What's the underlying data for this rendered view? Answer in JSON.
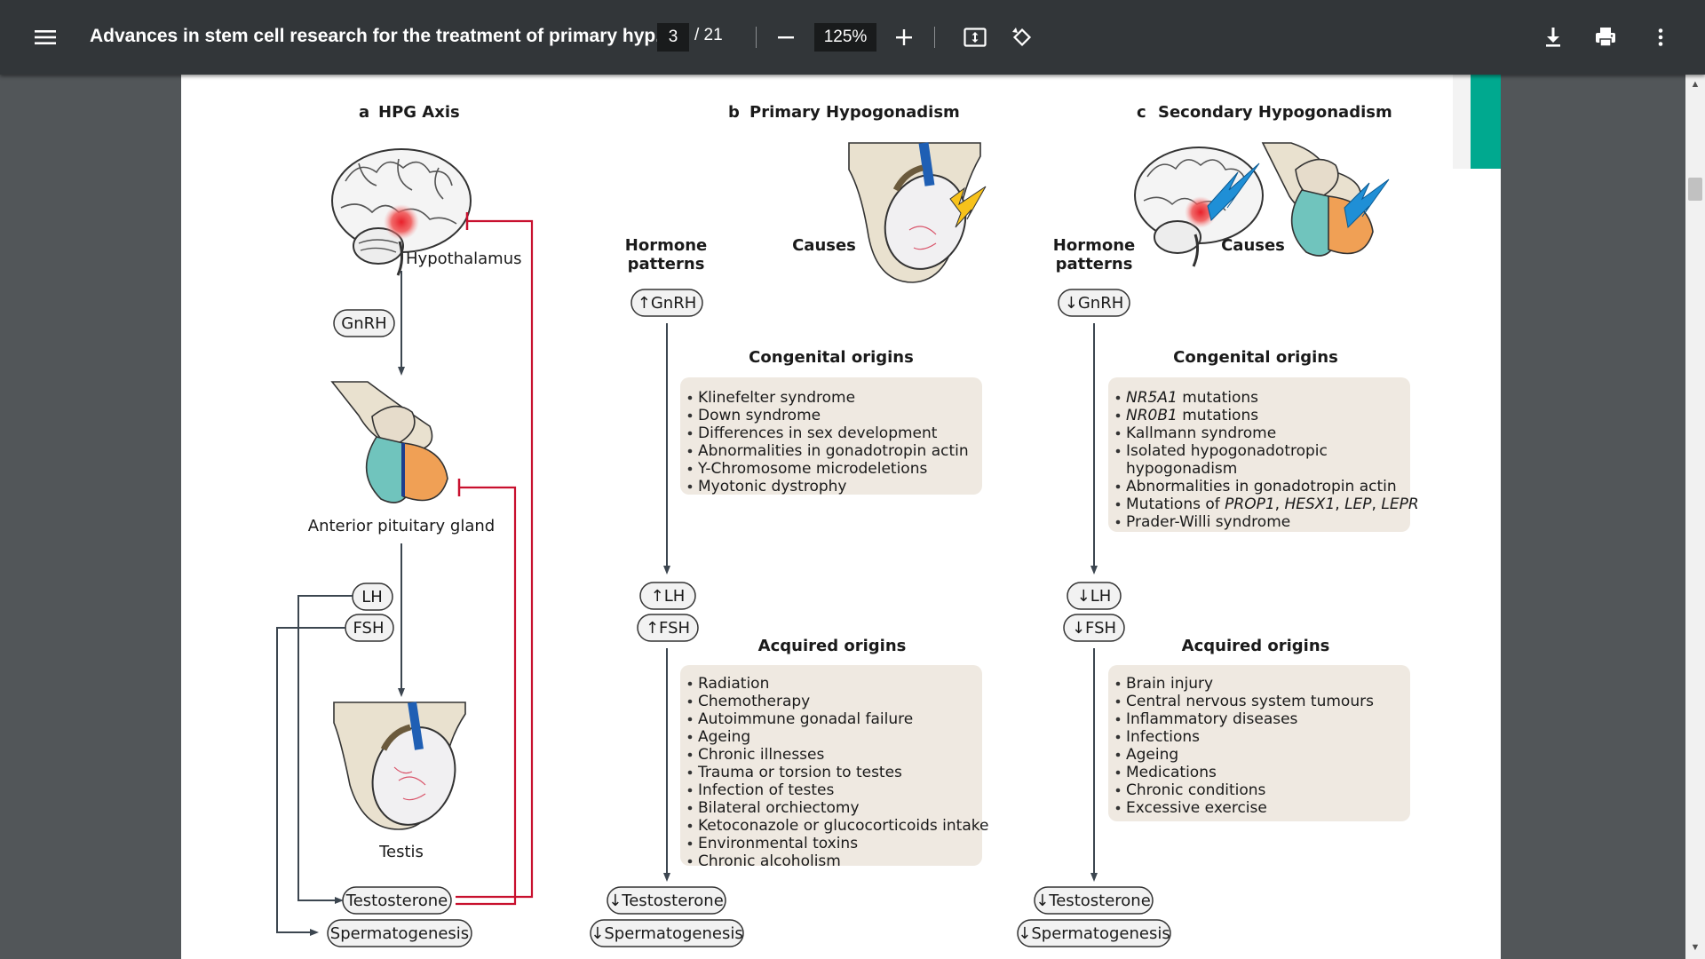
{
  "toolbar": {
    "title": "Advances in stem cell research for the treatment of primary hyp...",
    "page_current": "3",
    "page_total": "/ 21",
    "zoom": "125%"
  },
  "figure": {
    "panel_a": {
      "letter": "a",
      "title": "HPG Axis",
      "hypothalamus": "Hypothalamus",
      "gnrh": "GnRH",
      "pituitary": "Anterior pituitary gland",
      "lh": "LH",
      "fsh": "FSH",
      "testis": "Testis",
      "testosterone": "Testosterone",
      "spermatogenesis": "Spermatogenesis"
    },
    "panel_b": {
      "letter": "b",
      "title": "Primary Hypogonadism",
      "hormone_patterns_1": "Hormone",
      "hormone_patterns_2": "patterns",
      "causes": "Causes",
      "gnrh": "↑GnRH",
      "lh": "↑LH",
      "fsh": "↑FSH",
      "testosterone": "↓Testosterone",
      "spermatogenesis": "↓Spermatogenesis",
      "congenital_title": "Congenital origins",
      "congenital": [
        "Klinefelter syndrome",
        "Down syndrome",
        "Differences in sex development",
        "Abnormalities in gonadotropin actin",
        "Y-Chromosome microdeletions",
        "Myotonic dystrophy"
      ],
      "acquired_title": "Acquired origins",
      "acquired": [
        "Radiation",
        "Chemotherapy",
        "Autoimmune gonadal failure",
        "Ageing",
        "Chronic illnesses",
        "Trauma or torsion to testes",
        "Infection of testes",
        "Bilateral orchiectomy",
        "Ketoconazole or glucocorticoids intake",
        "Environmental toxins",
        "Chronic alcoholism"
      ]
    },
    "panel_c": {
      "letter": "c",
      "title": "Secondary Hypogonadism",
      "hormone_patterns_1": "Hormone",
      "hormone_patterns_2": "patterns",
      "causes": "Causes",
      "gnrh": "↓GnRH",
      "lh": "↓LH",
      "fsh": "↓FSH",
      "testosterone": "↓Testosterone",
      "spermatogenesis": "↓Spermatogenesis",
      "congenital_title": "Congenital origins",
      "congenital": [
        "NR5A1 mutations",
        "NR0B1 mutations",
        "Kallmann syndrome",
        "Isolated hypogonadotropic",
        "hypogonadism",
        "Abnormalities in gonadotropin actin",
        "Mutations of PROP1, HESX1, LEP, LEPR",
        "Prader-Willi syndrome"
      ],
      "acquired_title": "Acquired origins",
      "acquired": [
        "Brain injury",
        "Central nervous system tumours",
        "Inflammatory diseases",
        "Infections",
        "Ageing",
        "Medications",
        "Chronic conditions",
        "Excessive exercise"
      ]
    }
  },
  "icons": [
    "menu-icon",
    "minus-icon",
    "plus-icon",
    "fit-page-icon",
    "rotate-icon",
    "download-icon",
    "print-icon",
    "more-vert-icon"
  ],
  "colors": {
    "toolbar": "#323639",
    "viewer_bg": "#525659",
    "inhibit_red": "#c8102e",
    "box_bg": "#efe9e1",
    "teal": "#70c4bd",
    "orange": "#f0a055",
    "bolt_blue": "#1f8fd6",
    "bolt_yellow": "#f7c21b",
    "bookmark_teal": "#00a98f"
  }
}
